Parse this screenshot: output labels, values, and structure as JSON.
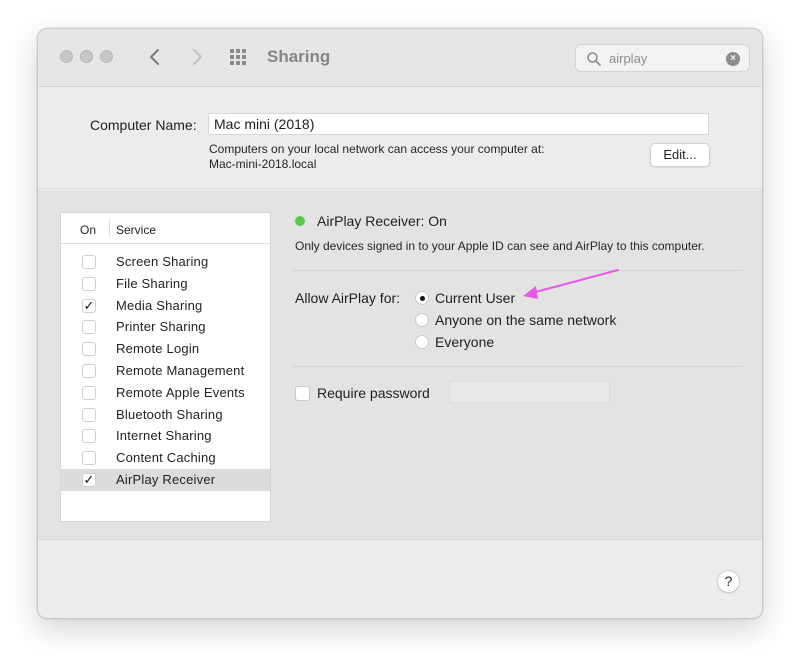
{
  "window": {
    "title": "Sharing"
  },
  "search": {
    "value": "airplay",
    "clear_glyph": "×"
  },
  "computer_name": {
    "label": "Computer Name:",
    "value": "Mac mini (2018)",
    "desc_line1": "Computers on your local network can access your computer at:",
    "desc_line2": "Mac-mini-2018.local",
    "edit_label": "Edit..."
  },
  "services": {
    "header_on": "On",
    "header_service": "Service",
    "items": [
      {
        "name": "Screen Sharing",
        "checked": false,
        "selected": false
      },
      {
        "name": "File Sharing",
        "checked": false,
        "selected": false
      },
      {
        "name": "Media Sharing",
        "checked": true,
        "selected": false
      },
      {
        "name": "Printer Sharing",
        "checked": false,
        "selected": false
      },
      {
        "name": "Remote Login",
        "checked": false,
        "selected": false
      },
      {
        "name": "Remote Management",
        "checked": false,
        "selected": false
      },
      {
        "name": "Remote Apple Events",
        "checked": false,
        "selected": false
      },
      {
        "name": "Bluetooth Sharing",
        "checked": false,
        "selected": false
      },
      {
        "name": "Internet Sharing",
        "checked": false,
        "selected": false
      },
      {
        "name": "Content Caching",
        "checked": false,
        "selected": false
      },
      {
        "name": "AirPlay Receiver",
        "checked": true,
        "selected": true
      }
    ],
    "check_glyph": "✓"
  },
  "detail": {
    "status_text": "AirPlay Receiver: On",
    "status_color": "#5ac84d",
    "description": "Only devices signed in to your Apple ID can see and AirPlay to this computer.",
    "allow_label": "Allow AirPlay for:",
    "options": [
      {
        "label": "Current User",
        "selected": true
      },
      {
        "label": "Anyone on the same network",
        "selected": false
      },
      {
        "label": "Everyone",
        "selected": false
      }
    ],
    "require_password_label": "Require password",
    "require_password_checked": false
  },
  "annotation": {
    "arrow_color": "#e65ae6"
  },
  "help": {
    "label": "?"
  }
}
